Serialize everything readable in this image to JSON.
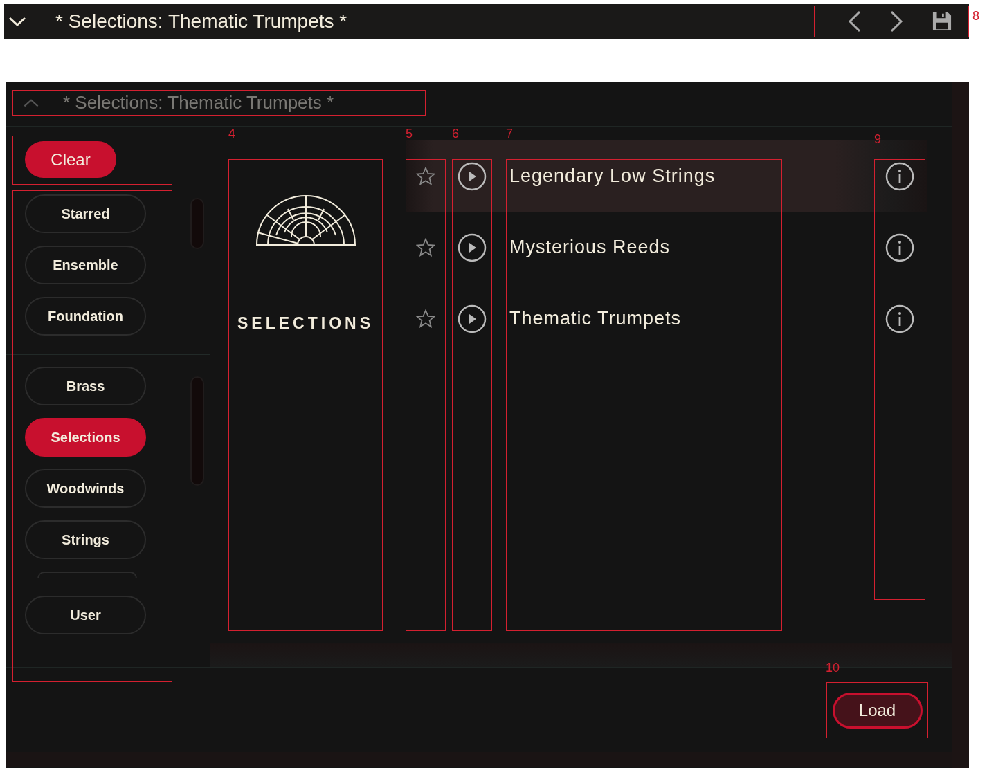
{
  "top_bar": {
    "title": "* Selections: Thematic Trumpets *"
  },
  "browser": {
    "title": "* Selections: Thematic Trumpets *"
  },
  "clear_button": "Clear",
  "filter_groups": [
    {
      "items": [
        {
          "label": "Starred",
          "selected": false
        },
        {
          "label": "Ensemble",
          "selected": false
        },
        {
          "label": "Foundation",
          "selected": false
        }
      ]
    },
    {
      "items": [
        {
          "label": "Brass",
          "selected": false
        },
        {
          "label": "Selections",
          "selected": true
        },
        {
          "label": "Woodwinds",
          "selected": false
        },
        {
          "label": "Strings",
          "selected": false
        }
      ],
      "more_below": true
    },
    {
      "items": [
        {
          "label": "User",
          "selected": false
        }
      ]
    }
  ],
  "category_title": "SELECTIONS",
  "presets": [
    {
      "name": "Legendary Low Strings",
      "starred": false,
      "selected": true
    },
    {
      "name": "Mysterious Reeds",
      "starred": false,
      "selected": false
    },
    {
      "name": "Thematic Trumpets",
      "starred": false,
      "selected": false
    }
  ],
  "load_button": "Load",
  "callouts": {
    "library": "4",
    "star": "5",
    "play": "6",
    "name": "7",
    "nav": "8",
    "info": "9",
    "load": "10"
  }
}
